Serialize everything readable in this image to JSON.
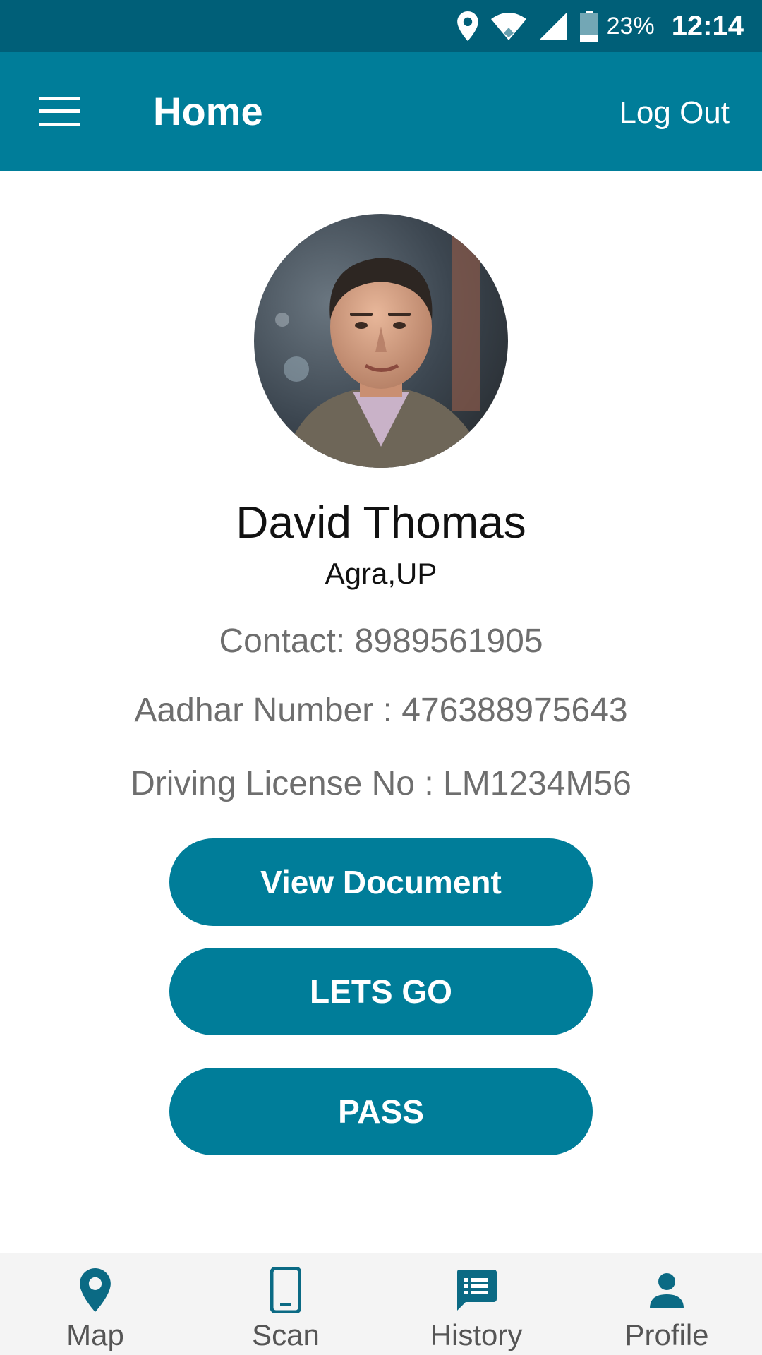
{
  "status_bar": {
    "battery_percent": "23%",
    "time": "12:14",
    "icons": [
      "location-icon",
      "wifi-icon",
      "cellular-signal-icon",
      "battery-icon"
    ]
  },
  "app_bar": {
    "title": "Home",
    "logout_label": "Log Out",
    "menu_icon": "hamburger-menu-icon"
  },
  "profile": {
    "name": "David Thomas",
    "location": "Agra,UP",
    "contact": "Contact: 8989561905",
    "aadhar": "Aadhar Number : 476388975643",
    "license": "Driving License No : LM1234M56"
  },
  "buttons": {
    "view_document": "View Document",
    "lets_go": "LETS GO",
    "pass": "PASS"
  },
  "bottom_nav": {
    "items": [
      {
        "label": "Map",
        "icon": "map-pin-icon"
      },
      {
        "label": "Scan",
        "icon": "phone-icon"
      },
      {
        "label": "History",
        "icon": "history-chat-icon"
      },
      {
        "label": "Profile",
        "icon": "person-icon"
      }
    ]
  },
  "colors": {
    "status_bar": "#005f78",
    "app_bar": "#007d99",
    "button": "#007d99",
    "nav_icon": "#0b6a84",
    "bottom_nav_bg": "#f4f4f4"
  }
}
